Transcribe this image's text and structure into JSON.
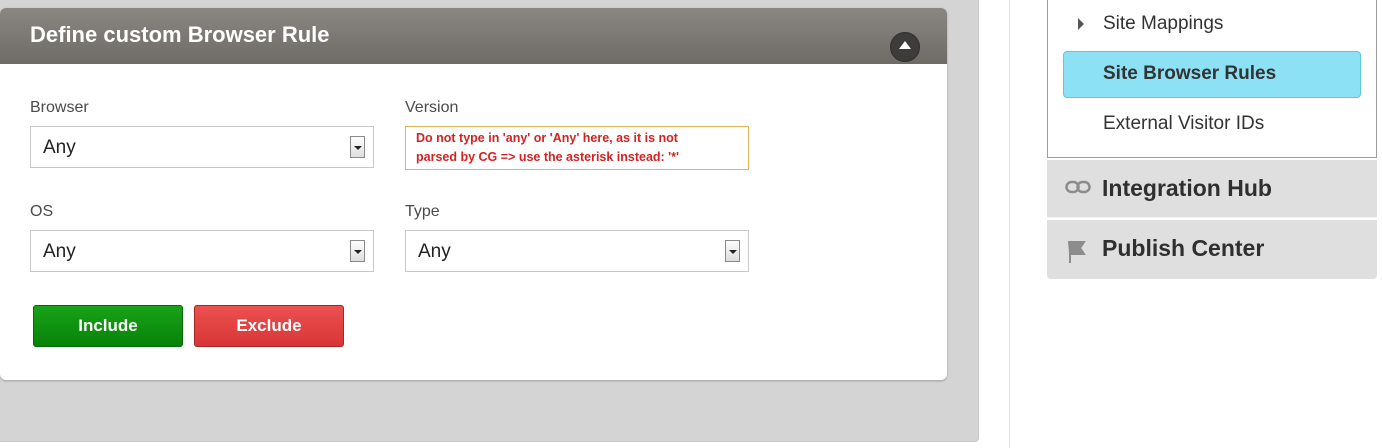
{
  "panel": {
    "title": "Define custom Browser Rule",
    "collapse_icon": "chevron-up-icon"
  },
  "form": {
    "browser": {
      "label": "Browser",
      "value": "Any"
    },
    "version": {
      "label": "Version",
      "note": "Do not type in 'any' or 'Any' here, as it is not\nparsed by CG => use the asterisk instead: '*'"
    },
    "os": {
      "label": "OS",
      "value": "Any"
    },
    "type": {
      "label": "Type",
      "value": "Any"
    }
  },
  "buttons": {
    "include": "Include",
    "exclude": "Exclude"
  },
  "sidebar": {
    "items": [
      {
        "label": "Site Mappings",
        "icon": "triangle-right-icon"
      },
      {
        "label": "Site Browser Rules",
        "active": true
      },
      {
        "label": "External Visitor IDs"
      }
    ],
    "sections": [
      {
        "label": "Integration Hub",
        "icon": "link-icon"
      },
      {
        "label": "Publish Center",
        "icon": "flag-icon"
      }
    ]
  },
  "colors": {
    "header": "#7a7772",
    "active_item": "#8de1f4",
    "include": "#0c8c0c",
    "exclude": "#e04444",
    "note_text": "#d42222"
  }
}
